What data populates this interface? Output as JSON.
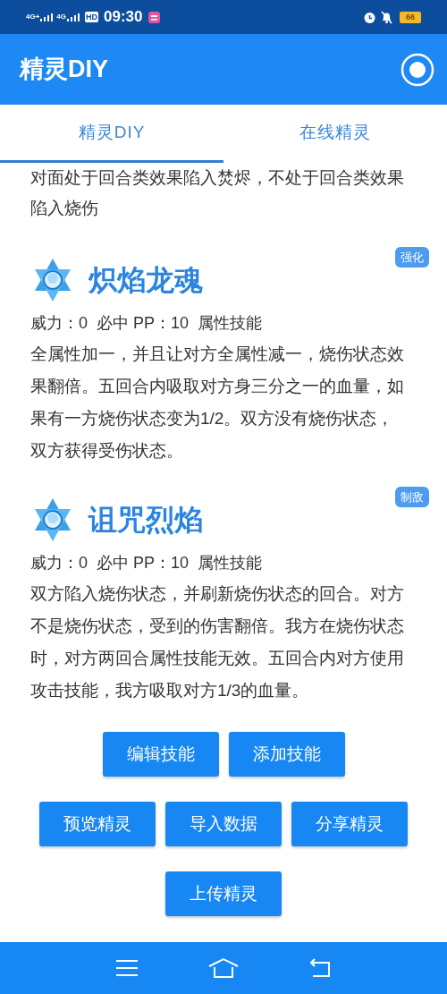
{
  "status_bar": {
    "network_1": "4G+",
    "network_2": "4G",
    "hd": "HD",
    "time": "09:30",
    "battery": "66"
  },
  "app_bar": {
    "title": "精灵DIY"
  },
  "tabs": [
    {
      "label": "精灵DIY",
      "selected": true
    },
    {
      "label": "在线精灵",
      "selected": false
    }
  ],
  "intro_text": "对面处于回合类效果陷入焚烬，不处于回合类效果陷入烧伤",
  "skills": [
    {
      "name": "炽焰龙魂",
      "tag": "强化",
      "stats": "威力：0  必中 PP：10  属性技能",
      "description": "全属性加一，并且让对方全属性减一，烧伤状态效果翻倍。五回合内吸取对方身三分之一的血量，如果有一方烧伤状态变为1/2。双方没有烧伤状态，双方获得受伤状态。"
    },
    {
      "name": "诅咒烈焰",
      "tag": "制敌",
      "stats": "威力：0  必中 PP：10  属性技能",
      "description": "双方陷入烧伤状态，并刷新烧伤状态的回合。对方不是烧伤状态，受到的伤害翻倍。我方在烧伤状态时，对方两回合属性技能无效。五回合内对方使用攻击技能，我方吸取对方1/3的血量。"
    }
  ],
  "button_rows": [
    [
      "编辑技能",
      "添加技能"
    ],
    [
      "预览精灵",
      "导入数据",
      "分享精灵"
    ],
    [
      "上传精灵"
    ]
  ]
}
